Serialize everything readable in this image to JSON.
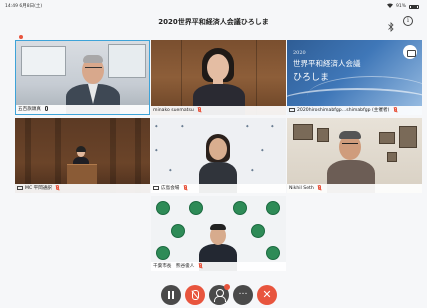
{
  "status": {
    "time": "14:49",
    "date": "6月8日(土)",
    "battery": "91%"
  },
  "header": {
    "title": "2020世界平和経済人会議ひろしま",
    "info_glyph": "i"
  },
  "participants": [
    {
      "name": "五百旗頭真",
      "icon": "mic-on-icon"
    },
    {
      "name": "minako suematsu",
      "icon": "mic-muted-icon"
    },
    {
      "name": "2020hiroshimabfgp…shimabfgp (主催者)",
      "icon": "mic-muted-icon",
      "screen_share": true
    },
    {
      "name": "MC 平岡通訳",
      "icon": "mic-muted-icon",
      "screen_share": true
    },
    {
      "name": "広島会場",
      "icon": "mic-muted-icon",
      "screen_share": true
    },
    {
      "name": "Nikhil Seth",
      "icon": "mic-muted-icon"
    },
    {
      "name": "千葉市長　熊谷俊人",
      "icon": "mic-muted-icon"
    }
  ],
  "banner": {
    "line1": "2020",
    "line2": "世界平和経済人会議",
    "line3": "ひろしま"
  },
  "controls": {
    "more_glyph": "…",
    "leave_glyph": "✕"
  },
  "colors": {
    "accent_red": "#e8553e",
    "active_border": "#3ea3d8",
    "control_dark": "#4a4a4a"
  }
}
